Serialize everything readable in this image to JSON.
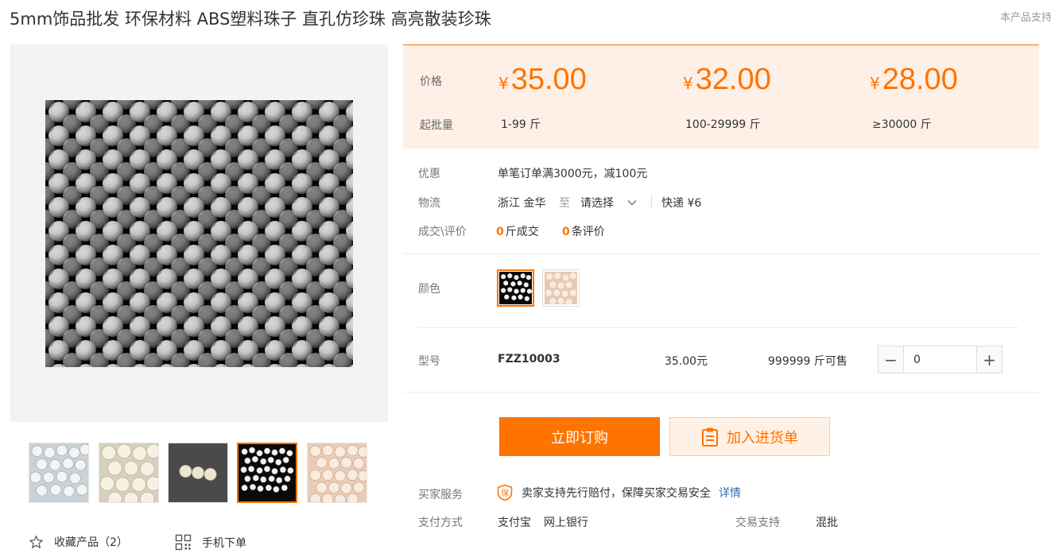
{
  "product": {
    "title": "5mm饰品批发 环保材料 ABS塑料珠子 直孔仿珍珠 高亮散装珍珠",
    "top_note": "本产品支持"
  },
  "gallery": {
    "actions": {
      "favorite_label": "收藏产品（2）",
      "mobile_label": "手机下单"
    }
  },
  "pricing": {
    "price_label": "价格",
    "moq_label": "起批量",
    "currency": "¥",
    "tiers": [
      {
        "price": "35.00",
        "qty": "1-99 斤"
      },
      {
        "price": "32.00",
        "qty": "100-29999 斤"
      },
      {
        "price": "28.00",
        "qty": "≥30000 斤"
      }
    ]
  },
  "promo": {
    "label": "优惠",
    "text": "单笔订单满3000元，减100元"
  },
  "shipping": {
    "label": "物流",
    "origin": "浙江 金华",
    "to": "至",
    "select_placeholder": "请选择",
    "method": "快递 ¥6"
  },
  "stats": {
    "label": "成交\\评价",
    "deals_count": "0",
    "deals_text": "斤成交",
    "reviews_count": "0",
    "reviews_text": "条评价"
  },
  "color": {
    "label": "颜色"
  },
  "sku": {
    "label": "型号",
    "model": "FZZ10003",
    "price": "35.00元",
    "stock": "999999 斤可售",
    "quantity": "0"
  },
  "buttons": {
    "buy_now": "立即订购",
    "add_to_cart": "加入进货单"
  },
  "service": {
    "buyer_label": "买家服务",
    "buyer_badge": "保",
    "buyer_text": "卖家支持先行赔付，保障买家交易安全",
    "details_link": "详情",
    "pay_label": "支付方式",
    "pay_methods": [
      "支付宝",
      "网上银行"
    ],
    "trade_label": "交易支持",
    "trade_value": "混批"
  },
  "colors": {
    "accent": "#ff7300",
    "price_bg": "#fef0e6",
    "link": "#2b6cb0"
  }
}
